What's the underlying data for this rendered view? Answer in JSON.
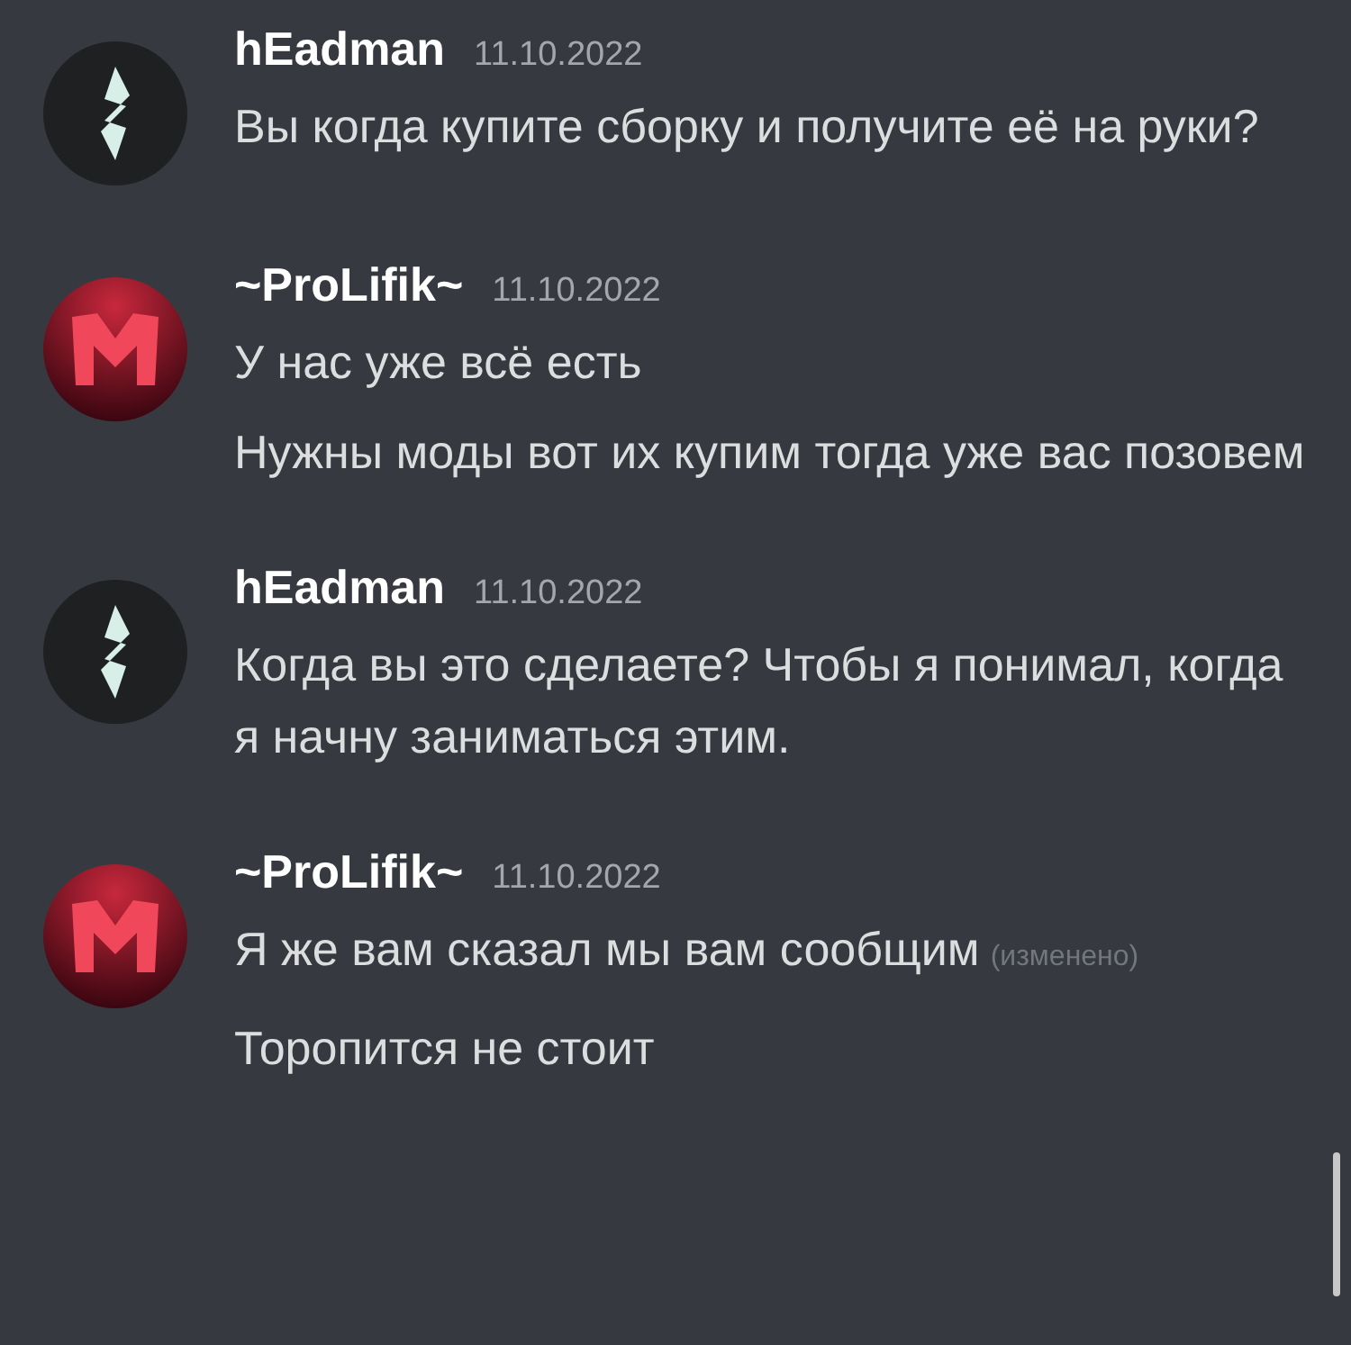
{
  "messages": [
    {
      "author": "hEadman",
      "timestamp": "11.10.2022",
      "avatar": {
        "kind": "bolt"
      },
      "lines": [
        {
          "text": "Вы когда купите сборку и получите её на руки?"
        }
      ]
    },
    {
      "author": "~ProLifik~",
      "timestamp": "11.10.2022",
      "avatar": {
        "kind": "letter-m"
      },
      "lines": [
        {
          "text": "У нас уже всё есть"
        },
        {
          "text": "Нужны моды вот их купим тогда уже вас позовем"
        }
      ]
    },
    {
      "author": "hEadman",
      "timestamp": "11.10.2022",
      "avatar": {
        "kind": "bolt"
      },
      "lines": [
        {
          "text": "Когда вы это сделаете? Чтобы я понимал, когда я начну заниматься этим."
        }
      ]
    },
    {
      "author": "~ProLifik~",
      "timestamp": "11.10.2022",
      "avatar": {
        "kind": "letter-m"
      },
      "lines": [
        {
          "text": "Я же вам сказал мы вам сообщим",
          "edited_tag": "(изменено)"
        },
        {
          "text": "Торопится не стоит"
        }
      ]
    }
  ]
}
